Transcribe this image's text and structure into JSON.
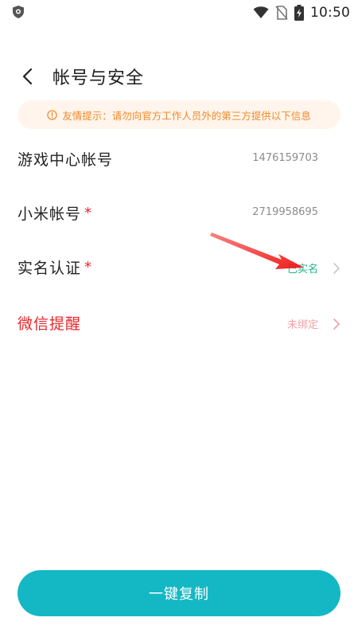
{
  "status_bar": {
    "time": "10:50",
    "icons": [
      "shield-app-icon",
      "wifi-icon",
      "no-sim-icon",
      "battery-charging-icon"
    ]
  },
  "header": {
    "title": "帐号与安全",
    "back_icon": "chevron-left-icon"
  },
  "notice": {
    "icon": "info-circle-icon",
    "text": "友情提示：请勿向官方工作人员外的第三方提供以下信息"
  },
  "rows": [
    {
      "label": "游戏中心帐号",
      "required": false,
      "value": "1476159703",
      "has_chevron": false
    },
    {
      "label": "小米帐号",
      "required": true,
      "value": "2719958695",
      "has_chevron": false
    },
    {
      "label": "实名认证",
      "required": true,
      "value": "已实名",
      "has_chevron": true
    },
    {
      "label": "微信提醒",
      "required": false,
      "value": "未绑定",
      "has_chevron": true
    }
  ],
  "required_mark": "*",
  "bottom_button": {
    "label": "一键复制"
  },
  "colors": {
    "accent": "#14b8c4",
    "required_red": "#e8262b",
    "verified_green": "#1fb68e",
    "notice_orange": "#f08a2a",
    "notice_bg": "#fff5ec",
    "unbound_pink": "#f3a0a6"
  }
}
